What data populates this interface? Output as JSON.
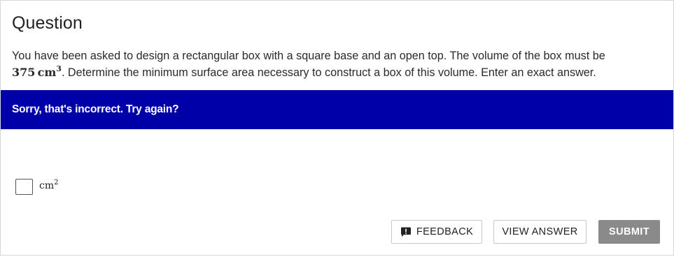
{
  "question": {
    "heading": "Question",
    "text_part1": "You have been asked to design a rectangular box with a square base and an open top. The volume of the box must be",
    "math_value": "375",
    "math_unit": "cm",
    "math_exponent": "3",
    "text_part2": ". Determine the minimum surface area necessary to construct a box of this volume. Enter an exact answer."
  },
  "feedback": {
    "message": "Sorry, that's incorrect. Try again?",
    "banner_color": "#0000a8"
  },
  "answer": {
    "value": "",
    "unit": "cm",
    "unit_exponent": "2"
  },
  "buttons": {
    "feedback_label": "FEEDBACK",
    "feedback_icon": "speech-bubble-exclamation-icon",
    "view_answer_label": "VIEW ANSWER",
    "submit_label": "SUBMIT",
    "submit_color": "#8a8a8a"
  }
}
